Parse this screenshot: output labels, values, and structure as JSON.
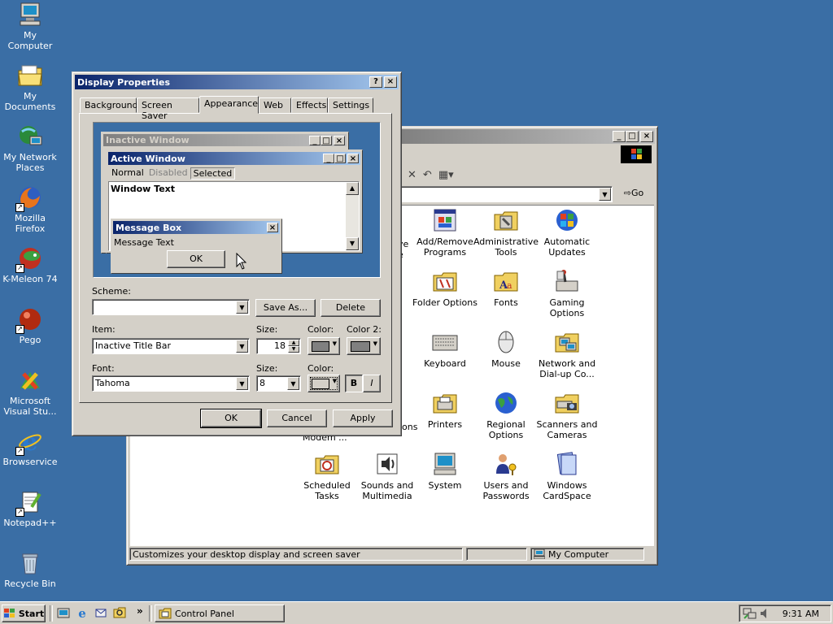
{
  "desktop": {
    "icons": [
      {
        "label": "My Computer",
        "icon": "computer-icon"
      },
      {
        "label": "My Documents",
        "icon": "folder-icon"
      },
      {
        "label": "My Network Places",
        "icon": "network-icon"
      },
      {
        "label": "Mozilla Firefox",
        "icon": "firefox-icon"
      },
      {
        "label": "K-Meleon 74",
        "icon": "kmeleon-icon"
      },
      {
        "label": "Pego",
        "icon": "pego-icon"
      },
      {
        "label": "Microsoft Visual Stu...",
        "icon": "visual-studio-icon"
      },
      {
        "label": "Browservice",
        "icon": "ie-icon"
      },
      {
        "label": "Notepad++",
        "icon": "notepad-icon"
      },
      {
        "label": "Recycle Bin",
        "icon": "recycle-bin-icon"
      }
    ]
  },
  "control_panel": {
    "go_label": "Go",
    "status_text": "Customizes your desktop display and screen saver",
    "status_location": "My Computer",
    "partial_labels": {
      "row1_left": "ve",
      "row1_left2": "e",
      "row4_left": "ons",
      "row4_modem": "Modem ..."
    },
    "items": [
      {
        "label": "Add/Remove Programs",
        "icon": "add-remove-programs-icon"
      },
      {
        "label": "Administrative Tools",
        "icon": "administrative-tools-icon"
      },
      {
        "label": "Automatic Updates",
        "icon": "automatic-updates-icon"
      },
      {
        "label": "Folder Options",
        "icon": "folder-options-icon"
      },
      {
        "label": "Fonts",
        "icon": "fonts-icon"
      },
      {
        "label": "Gaming Options",
        "icon": "gaming-options-icon"
      },
      {
        "label": "Keyboard",
        "icon": "keyboard-icon"
      },
      {
        "label": "Mouse",
        "icon": "mouse-icon"
      },
      {
        "label": "Network and Dial-up Co...",
        "icon": "network-dialup-icon"
      },
      {
        "label": "Printers",
        "icon": "printers-icon"
      },
      {
        "label": "Regional Options",
        "icon": "regional-options-icon"
      },
      {
        "label": "Scanners and Cameras",
        "icon": "scanners-cameras-icon"
      },
      {
        "label": "Scheduled Tasks",
        "icon": "scheduled-tasks-icon"
      },
      {
        "label": "Sounds and Multimedia",
        "icon": "sounds-multimedia-icon"
      },
      {
        "label": "System",
        "icon": "system-icon"
      },
      {
        "label": "Users and Passwords",
        "icon": "users-passwords-icon"
      },
      {
        "label": "Windows CardSpace",
        "icon": "cardspace-icon"
      }
    ]
  },
  "dialog": {
    "title": "Display Properties",
    "help_btn": "?",
    "close_btn": "×",
    "tabs": [
      "Background",
      "Screen Saver",
      "Appearance",
      "Web",
      "Effects",
      "Settings"
    ],
    "preview": {
      "inactive_title": "Inactive Window",
      "active_title": "Active Window",
      "menu": [
        "Normal",
        "Disabled",
        "Selected"
      ],
      "window_text": "Window Text",
      "msgbox_title": "Message Box",
      "msgbox_text": "Message Text",
      "msgbox_ok": "OK"
    },
    "scheme_label": "Scheme:",
    "scheme_value": "",
    "save_as": "Save As...",
    "delete": "Delete",
    "item_label": "Item:",
    "item_value": "Inactive Title Bar",
    "size_label": "Size:",
    "item_size": "18",
    "color_label": "Color:",
    "color2_label": "Color 2:",
    "font_label": "Font:",
    "font_value": "Tahoma",
    "font_size_label": "Size:",
    "font_size": "8",
    "font_color_label": "Color:",
    "bold": "B",
    "italic": "I",
    "ok": "OK",
    "cancel": "Cancel",
    "apply": "Apply"
  },
  "taskbar": {
    "start": "Start",
    "task": "Control Panel",
    "chevron": "»",
    "clock": "9:31 AM"
  }
}
